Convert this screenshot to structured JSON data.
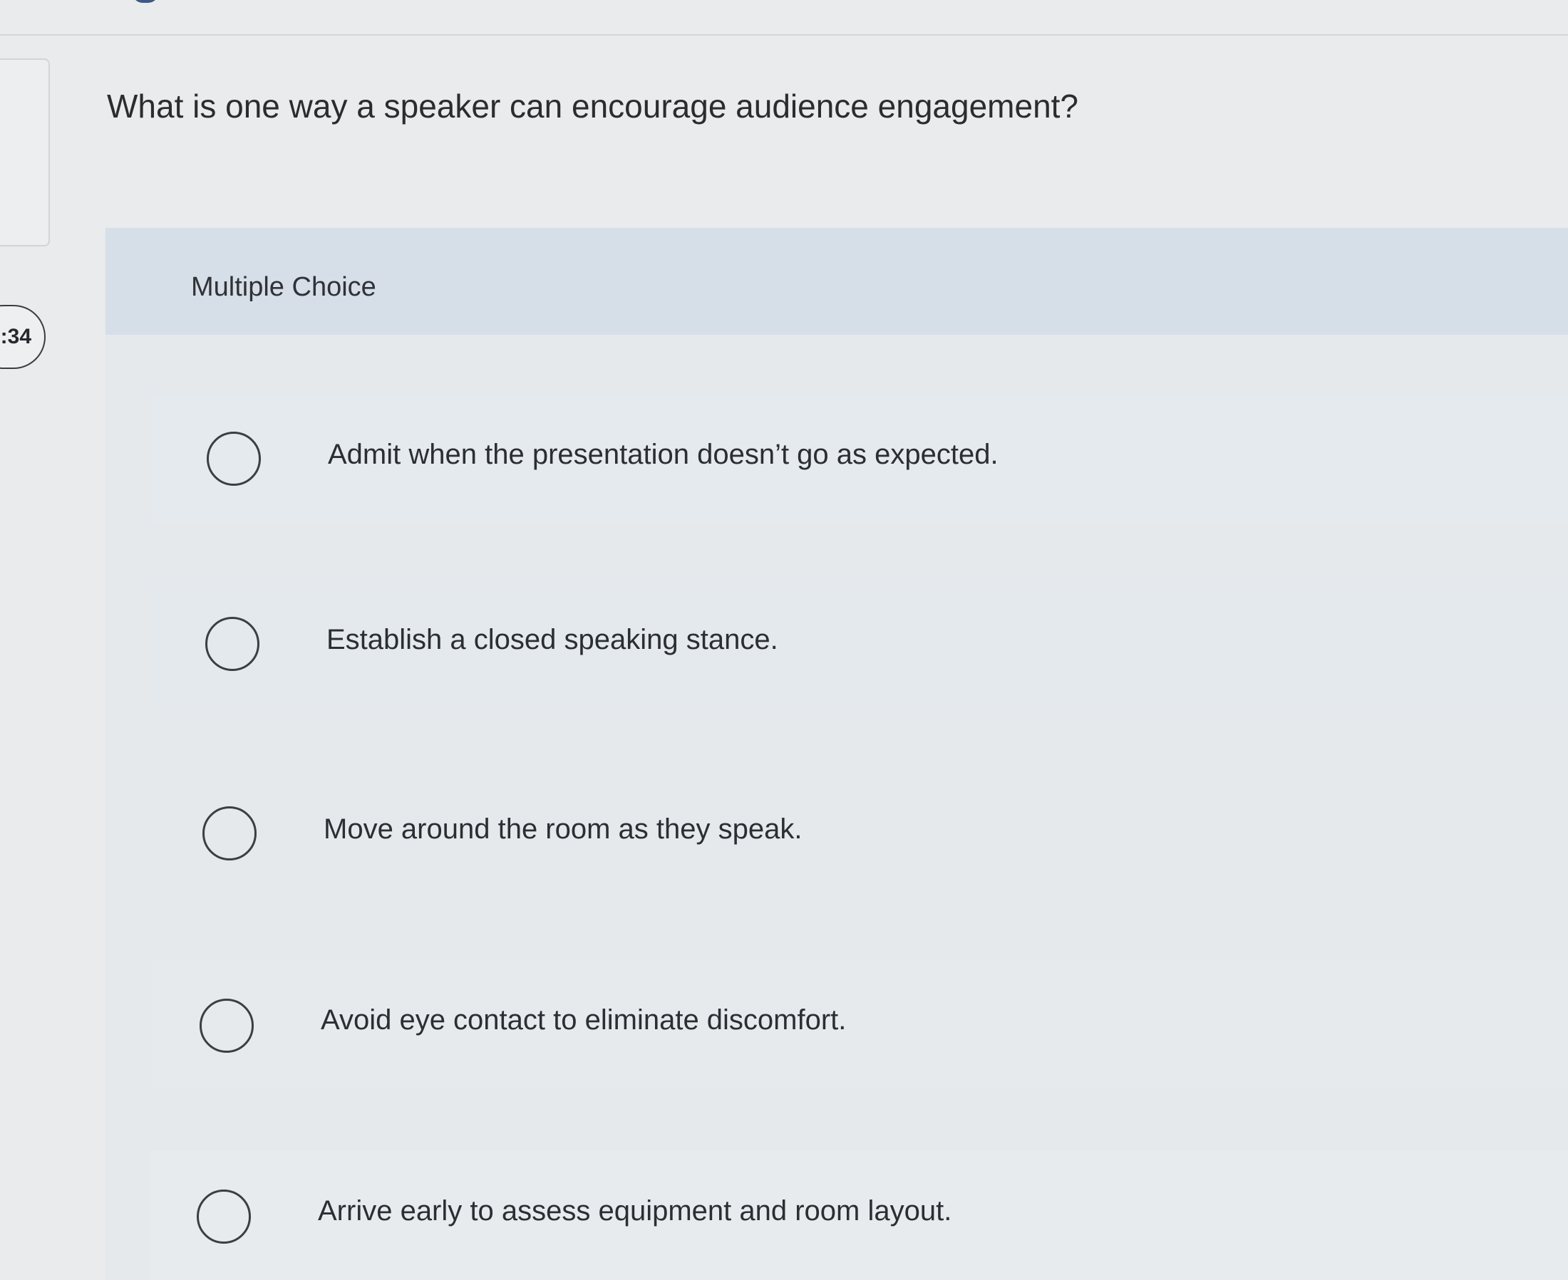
{
  "timer": {
    "text": ":34"
  },
  "question": {
    "text": "What is one way a speaker can encourage audience engagement?",
    "type_label": "Multiple Choice"
  },
  "choices": [
    {
      "label": "Admit when the presentation doesn’t go as expected.",
      "selected": false
    },
    {
      "label": "Establish a closed speaking stance.",
      "selected": false
    },
    {
      "label": "Move around the room as they speak.",
      "selected": false
    },
    {
      "label": "Avoid eye contact to eliminate discomfort.",
      "selected": false
    },
    {
      "label": "Arrive early to assess equipment and room layout.",
      "selected": false
    }
  ],
  "colors": {
    "page_background": "#e9ebec",
    "header_band": "#d6dee8",
    "text": "#2b2d31",
    "radio_border": "#3b3e43"
  },
  "icons": {
    "radio": "radio-unselected-icon"
  }
}
